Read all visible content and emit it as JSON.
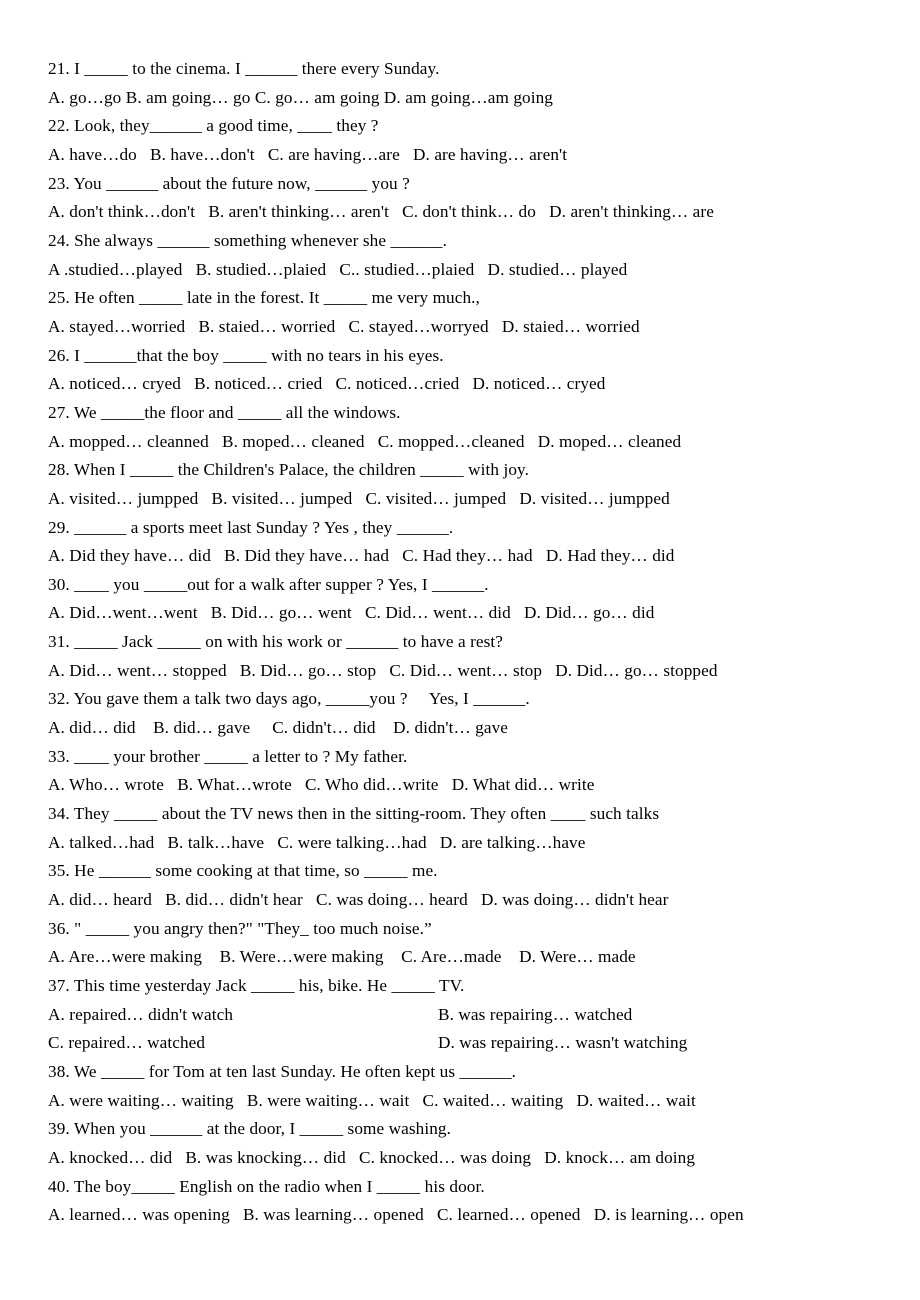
{
  "document": {
    "type": "grammar-multiple-choice-worksheet",
    "first_question_number": 21,
    "last_question_number": 40
  },
  "questions": [
    {
      "number": "21",
      "stem": "21. I _____ to the cinema. I ______ there every Sunday.",
      "options": "A. go…go B. am going… go C. go… am going D. am going…am going"
    },
    {
      "number": "22",
      "stem": "22. Look, they______ a good time, ____ they ?",
      "options": "A. have…do   B. have…don't   C. are having…are   D. are having… aren't"
    },
    {
      "number": "23",
      "stem": "23. You ______ about the future now, ______ you ?",
      "options": "A. don't think…don't   B. aren't thinking… aren't   C. don't think… do   D. aren't thinking… are"
    },
    {
      "number": "24",
      "stem": "24. She always ______ something whenever she ______.",
      "options": "A .studied…played   B. studied…plaied   C.. studied…plaied   D. studied… played"
    },
    {
      "number": "25",
      "stem": "25. He often _____ late in the forest. It _____ me very much.,",
      "options": "A. stayed…worried   B. staied… worried   C. stayed…worryed   D. staied… worried"
    },
    {
      "number": "26",
      "stem": "26. I ______that the boy _____ with no tears in his eyes.",
      "options": "A. noticed… cryed   B. noticed… cried   C. noticed…cried   D. noticed… cryed"
    },
    {
      "number": "27",
      "stem": "27. We _____the floor and _____ all the windows.",
      "options": "A. mopped… cleanned   B. moped… cleaned   C. mopped…cleaned   D. moped… cleaned"
    },
    {
      "number": "28",
      "stem": "28. When I _____ the Children's Palace, the children _____ with joy.",
      "options": "A. visited… jumpped   B. visited… jumped   C. visited… jumped   D. visited… jumpped"
    },
    {
      "number": "29",
      "stem": "29. ______ a sports meet last Sunday ? Yes , they ______.",
      "options": "A. Did they have… did   B. Did they have… had   C. Had they… had   D. Had they… did"
    },
    {
      "number": "30",
      "stem": "30. ____ you _____out for a walk after supper ? Yes, I ______.",
      "options": "A. Did…went…went   B. Did… go… went   C. Did… went… did   D. Did… go… did"
    },
    {
      "number": "31",
      "stem": "31. _____ Jack _____ on with his work or ______ to have a rest?",
      "options": "A. Did… went… stopped   B. Did… go… stop   C. Did… went… stop   D. Did… go… stopped"
    },
    {
      "number": "32",
      "stem": "32. You gave them a talk two days ago, _____you ?     Yes, I ______.",
      "options": "A. did… did    B. did… gave     C. didn't… did    D. didn't… gave"
    },
    {
      "number": "33",
      "stem": "33. ____ your brother _____ a letter to ? My father.",
      "options": "A. Who… wrote   B. What…wrote   C. Who did…write   D. What did… write"
    },
    {
      "number": "34",
      "stem": "34. They _____ about the TV news then in the sitting-room. They often ____ such talks",
      "options": "A. talked…had   B. talk…have   C. were talking…had   D. are talking…have"
    },
    {
      "number": "35",
      "stem": "35. He ______ some cooking at that time, so _____ me.",
      "options": "A. did… heard   B. did… didn't hear   C. was doing… heard   D. was doing… didn't hear"
    },
    {
      "number": "36",
      "stem": "36. \" _____ you angry then?\" \"They_ too much noise.”",
      "options": "A. Are…were making    B. Were…were making    C. Are…made    D. Were… made"
    },
    {
      "number": "37",
      "stem": "37. This time yesterday Jack _____ his, bike. He _____ TV.",
      "options_col_a_1": "A. repaired… didn't watch",
      "options_col_b_1": "B. was repairing… watched",
      "options_col_a_2": "C. repaired… watched",
      "options_col_b_2": "D. was repairing… wasn't watching"
    },
    {
      "number": "38",
      "stem": "38. We _____ for Tom at ten last Sunday. He often kept us ______.",
      "options": "A. were waiting… waiting   B. were waiting… wait   C. waited… waiting   D. waited… wait"
    },
    {
      "number": "39",
      "stem": "39. When you ______ at the door, I _____ some washing.",
      "options": "A. knocked… did   B. was knocking… did   C. knocked… was doing   D. knock… am doing"
    },
    {
      "number": "40",
      "stem": "40. The boy_____ English on the radio when I _____ his door.",
      "options": "A. learned… was opening   B. was learning… opened   C. learned… opened   D. is learning… open"
    }
  ]
}
